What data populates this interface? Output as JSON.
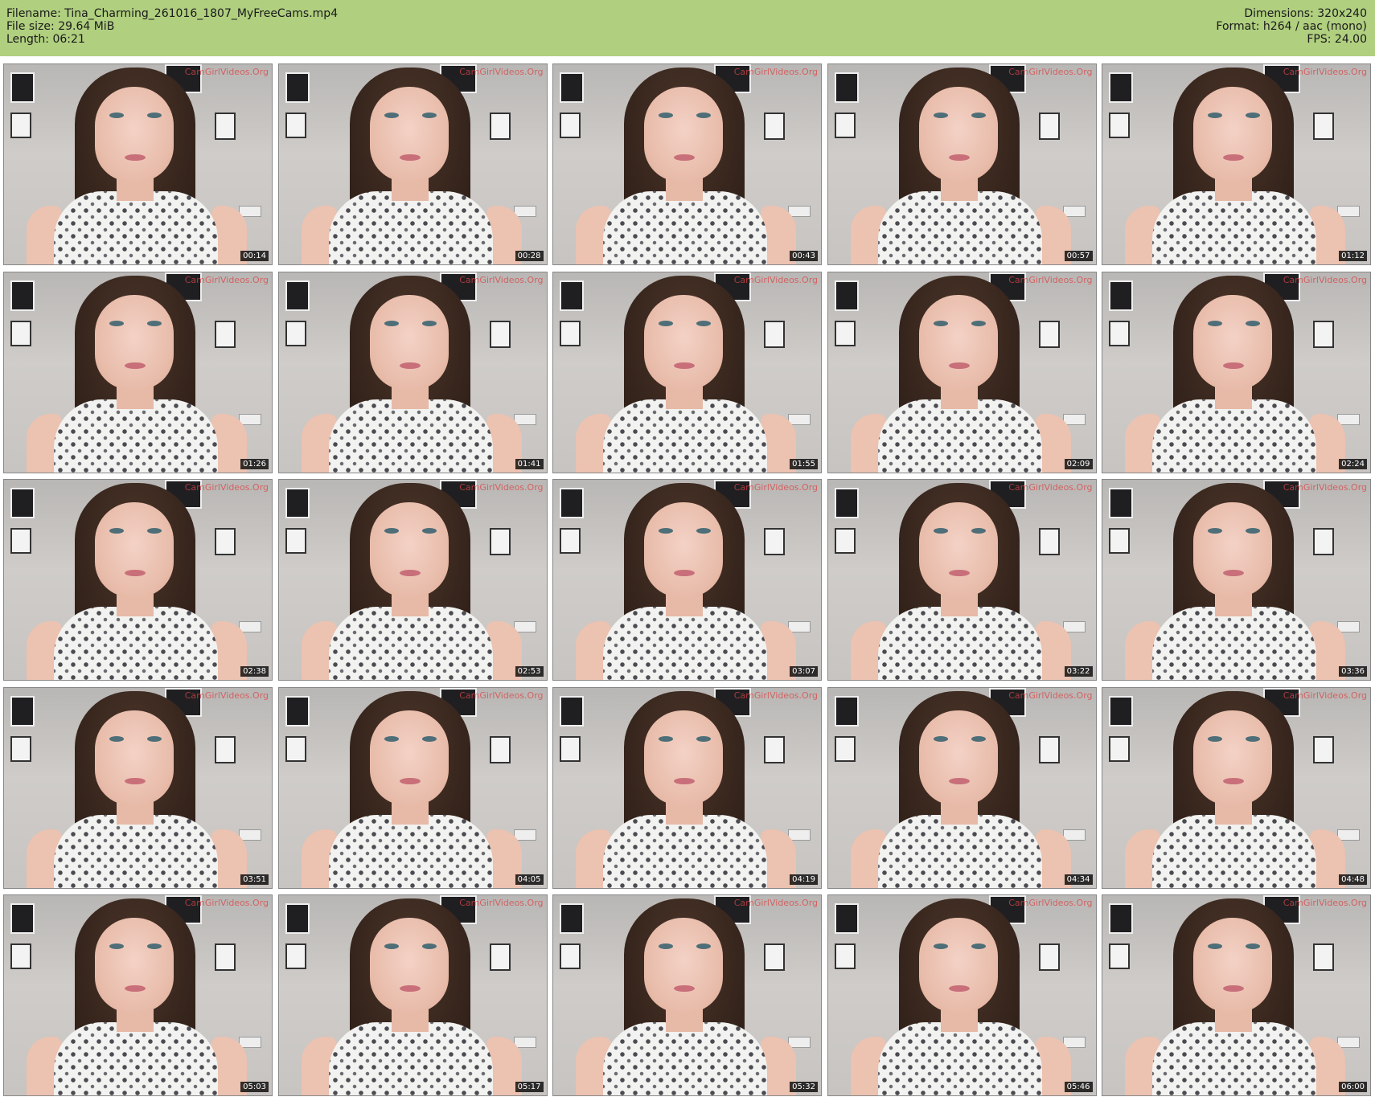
{
  "header": {
    "left": [
      "Filename: Tina_Charming_261016_1807_MyFreeCams.mp4",
      "File size: 29.64 MiB",
      "Length: 06:21"
    ],
    "right": [
      "Dimensions: 320x240",
      "Format: h264 / aac (mono)",
      "FPS: 24.00"
    ],
    "background_color": "#b0cf7f"
  },
  "thumbnails": [
    {
      "timestamp": "00:14"
    },
    {
      "timestamp": "00:28"
    },
    {
      "timestamp": "00:43"
    },
    {
      "timestamp": "00:57"
    },
    {
      "timestamp": "01:12"
    },
    {
      "timestamp": "01:26"
    },
    {
      "timestamp": "01:41"
    },
    {
      "timestamp": "01:55"
    },
    {
      "timestamp": "02:09"
    },
    {
      "timestamp": "02:24"
    },
    {
      "timestamp": "02:38"
    },
    {
      "timestamp": "02:53"
    },
    {
      "timestamp": "03:07"
    },
    {
      "timestamp": "03:22"
    },
    {
      "timestamp": "03:36"
    },
    {
      "timestamp": "03:51"
    },
    {
      "timestamp": "04:05"
    },
    {
      "timestamp": "04:19"
    },
    {
      "timestamp": "04:34"
    },
    {
      "timestamp": "04:48"
    },
    {
      "timestamp": "05:03"
    },
    {
      "timestamp": "05:17"
    },
    {
      "timestamp": "05:32"
    },
    {
      "timestamp": "05:46"
    },
    {
      "timestamp": "06:00"
    }
  ],
  "watermark": "CamGirlVideos.Org"
}
